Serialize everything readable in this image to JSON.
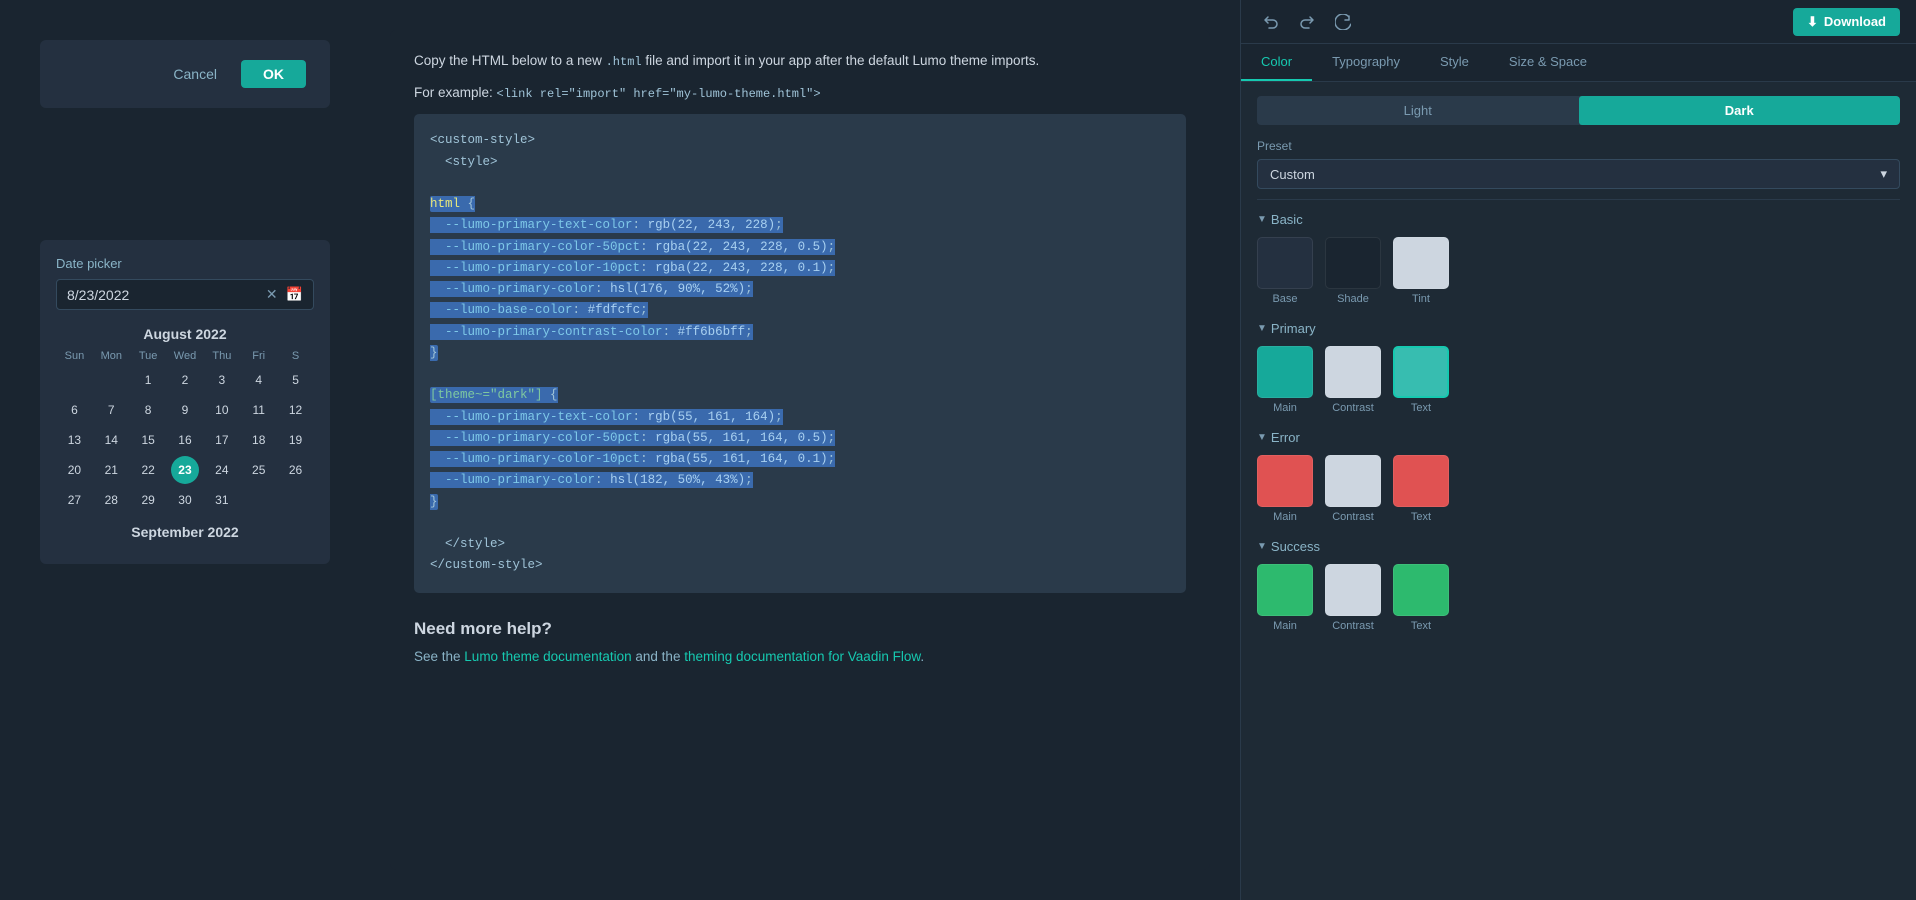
{
  "toolbar": {
    "undo_icon": "↩",
    "redo_icon": "↪",
    "refresh_icon": "↻",
    "download_label": "Download",
    "download_icon": "⬇"
  },
  "tabs": [
    {
      "id": "color",
      "label": "Color",
      "active": true
    },
    {
      "id": "typography",
      "label": "Typography",
      "active": false
    },
    {
      "id": "style",
      "label": "Style",
      "active": false
    },
    {
      "id": "size-space",
      "label": "Size & Space",
      "active": false
    }
  ],
  "mode": {
    "light_label": "Light",
    "dark_label": "Dark",
    "active": "dark"
  },
  "preset": {
    "label": "Preset",
    "value": "Custom",
    "chevron": "▾"
  },
  "basic_group": {
    "label": "Basic",
    "swatches": [
      {
        "name": "Base",
        "color": "#243040"
      },
      {
        "name": "Shade",
        "color": "#1a2530"
      },
      {
        "name": "Tint",
        "color": "#cdd6e0"
      }
    ]
  },
  "primary_group": {
    "label": "Primary",
    "swatches": [
      {
        "name": "Main",
        "color": "#16a99a"
      },
      {
        "name": "Contrast",
        "color": "#cdd6e0"
      },
      {
        "name": "Text",
        "color": "#37bdb0"
      }
    ]
  },
  "error_group": {
    "label": "Error",
    "swatches": [
      {
        "name": "Main",
        "color": "#e05252"
      },
      {
        "name": "Contrast",
        "color": "#cdd6e0"
      },
      {
        "name": "Text",
        "color": "#e05252"
      }
    ]
  },
  "success_group": {
    "label": "Success",
    "swatches": [
      {
        "name": "Main",
        "color": "#2dba6e"
      },
      {
        "name": "Contrast",
        "color": "#cdd6e0"
      },
      {
        "name": "Text",
        "color": "#2dba6e"
      }
    ]
  },
  "dialog": {
    "cancel_label": "Cancel",
    "ok_label": "OK"
  },
  "datepicker": {
    "label": "Date picker",
    "value": "8/23/2022",
    "month1": "August 2022",
    "month2": "September 2022",
    "dow": [
      "Sun",
      "Mon",
      "Tue",
      "Wed",
      "Thu",
      "Fri",
      "S"
    ],
    "aug_days": [
      "",
      "",
      "1",
      "2",
      "3",
      "4",
      "5",
      "6",
      "7",
      "8",
      "9",
      "10",
      "11",
      "12",
      "13",
      "14",
      "15",
      "16",
      "17",
      "18",
      "19",
      "20",
      "21",
      "22",
      "23",
      "24",
      "25",
      "26",
      "27",
      "28",
      "29",
      "30",
      "31"
    ],
    "selected_day": "23"
  },
  "code": {
    "intro1": "Copy the HTML below to a new ",
    "intro_code": ".html",
    "intro2": " file and import it in your app after the default Lumo theme imports.",
    "example_label": "For example: ",
    "example_code": "<link rel=\"import\" href=\"my-lumo-theme.html\">",
    "block": "<custom-style>\n  <style>\n\nhtml {\n  --lumo-primary-text-color: rgb(22, 243, 228);\n  --lumo-primary-color-50pct: rgba(22, 243, 228, 0.5);\n  --lumo-primary-color-10pct: rgba(22, 243, 228, 0.1);\n  --lumo-primary-color: hsl(176, 90%, 52%);\n  --lumo-base-color: #fdfcfc;\n  --lumo-primary-contrast-color: #ff6b6bff;\n}\n\n[theme~=\"dark\"] {\n  --lumo-primary-text-color: rgb(55, 161, 164);\n  --lumo-primary-color-50pct: rgba(55, 161, 164, 0.5);\n  --lumo-primary-color-10pct: rgba(55, 161, 164, 0.1);\n  --lumo-primary-color: hsl(182, 50%, 43%);\n}\n\n  </style>\n</custom-style>",
    "need_help_title": "Need more help?",
    "need_help_text1": "See the ",
    "link1": "Lumo theme documentation",
    "need_help_text2": " and the ",
    "link2": "theming documentation for Vaadin Flow",
    "need_help_text3": "."
  }
}
